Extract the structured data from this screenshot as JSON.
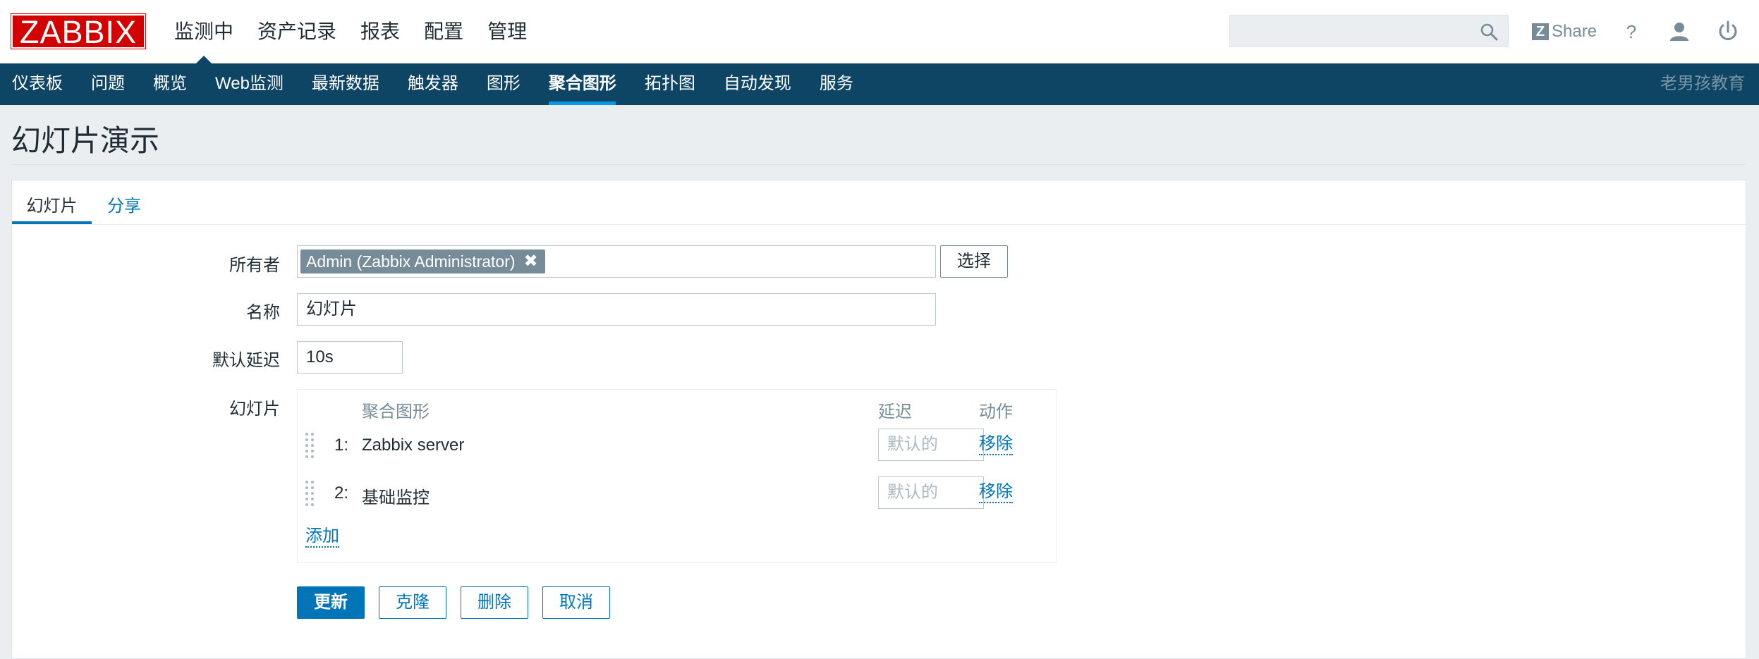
{
  "logo": "ZABBIX",
  "top_menu": [
    "监测中",
    "资产记录",
    "报表",
    "配置",
    "管理"
  ],
  "search": {
    "placeholder": ""
  },
  "share_label": "Share",
  "sub_menu": [
    "仪表板",
    "问题",
    "概览",
    "Web监测",
    "最新数据",
    "触发器",
    "图形",
    "聚合图形",
    "拓扑图",
    "自动发现",
    "服务"
  ],
  "brand": "老男孩教育",
  "page_title": "幻灯片演示",
  "tabs": [
    "幻灯片",
    "分享"
  ],
  "form": {
    "owner_label": "所有者",
    "owner_value": "Admin (Zabbix Administrator)",
    "select_button": "选择",
    "name_label": "名称",
    "name_value": "幻灯片",
    "delay_label": "默认延迟",
    "delay_value": "10s",
    "slides_label": "幻灯片"
  },
  "slides_table": {
    "headers": {
      "screen": "聚合图形",
      "delay": "延迟",
      "action": "动作"
    },
    "rows": [
      {
        "num": "1:",
        "name": "Zabbix server",
        "delay_placeholder": "默认的",
        "action": "移除"
      },
      {
        "num": "2:",
        "name": "基础监控",
        "delay_placeholder": "默认的",
        "action": "移除"
      }
    ],
    "add_label": "添加"
  },
  "buttons": {
    "update": "更新",
    "clone": "克隆",
    "delete": "删除",
    "cancel": "取消"
  },
  "colors": {
    "logo_red": "#d40000",
    "nav_blue": "#0e4565",
    "accent": "#0275b8",
    "chip_gray": "#768d99"
  }
}
